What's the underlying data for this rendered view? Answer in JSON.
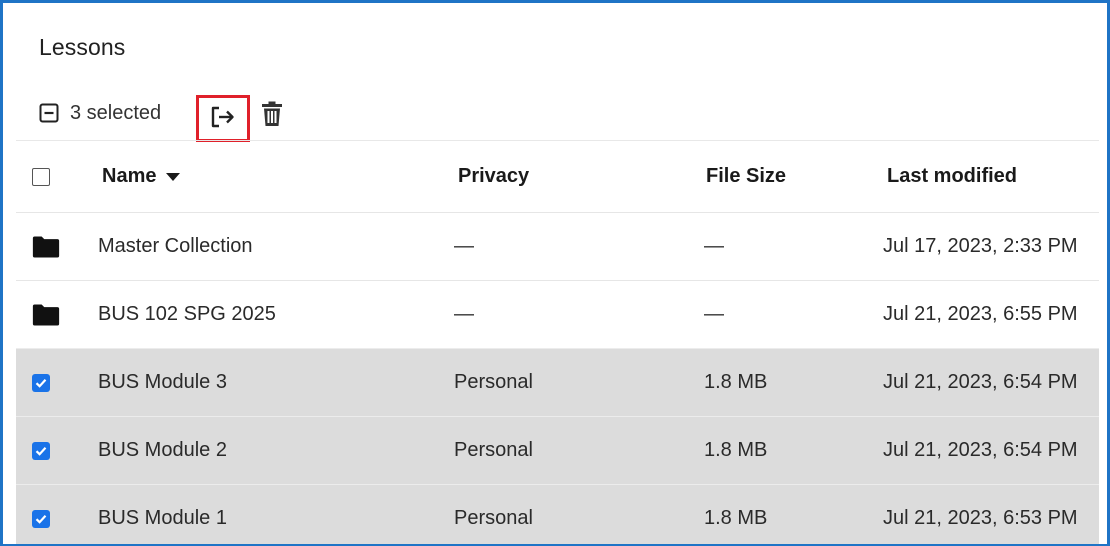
{
  "page": {
    "title": "Lessons"
  },
  "toolbar": {
    "selection_label": "3 selected",
    "selection_icon": "minus-square-icon",
    "move_icon": "move-out-icon",
    "delete_icon": "trash-icon",
    "highlight_color": "#e0202a"
  },
  "table": {
    "columns": {
      "name": "Name",
      "privacy": "Privacy",
      "file_size": "File Size",
      "last_modified": "Last modified"
    },
    "sort": {
      "column": "Name",
      "direction": "descending"
    },
    "rows": [
      {
        "type": "folder",
        "name": "Master Collection",
        "privacy": "—",
        "file_size": "—",
        "last_modified": "Jul 17, 2023, 2:33 PM",
        "selected": false
      },
      {
        "type": "folder",
        "name": "BUS 102 SPG 2025",
        "privacy": "—",
        "file_size": "—",
        "last_modified": "Jul 21, 2023, 6:55 PM",
        "selected": false
      },
      {
        "type": "file",
        "name": "BUS Module 3",
        "privacy": "Personal",
        "file_size": "1.8 MB",
        "last_modified": "Jul 21, 2023, 6:54 PM",
        "selected": true
      },
      {
        "type": "file",
        "name": "BUS Module 2",
        "privacy": "Personal",
        "file_size": "1.8 MB",
        "last_modified": "Jul 21, 2023, 6:54 PM",
        "selected": true
      },
      {
        "type": "file",
        "name": "BUS Module 1",
        "privacy": "Personal",
        "file_size": "1.8 MB",
        "last_modified": "Jul 21, 2023, 6:53 PM",
        "selected": true
      }
    ]
  },
  "colors": {
    "frame_border": "#1f74c6",
    "checkbox_checked": "#1a73e8",
    "selected_row_bg": "#dcdcdc"
  }
}
